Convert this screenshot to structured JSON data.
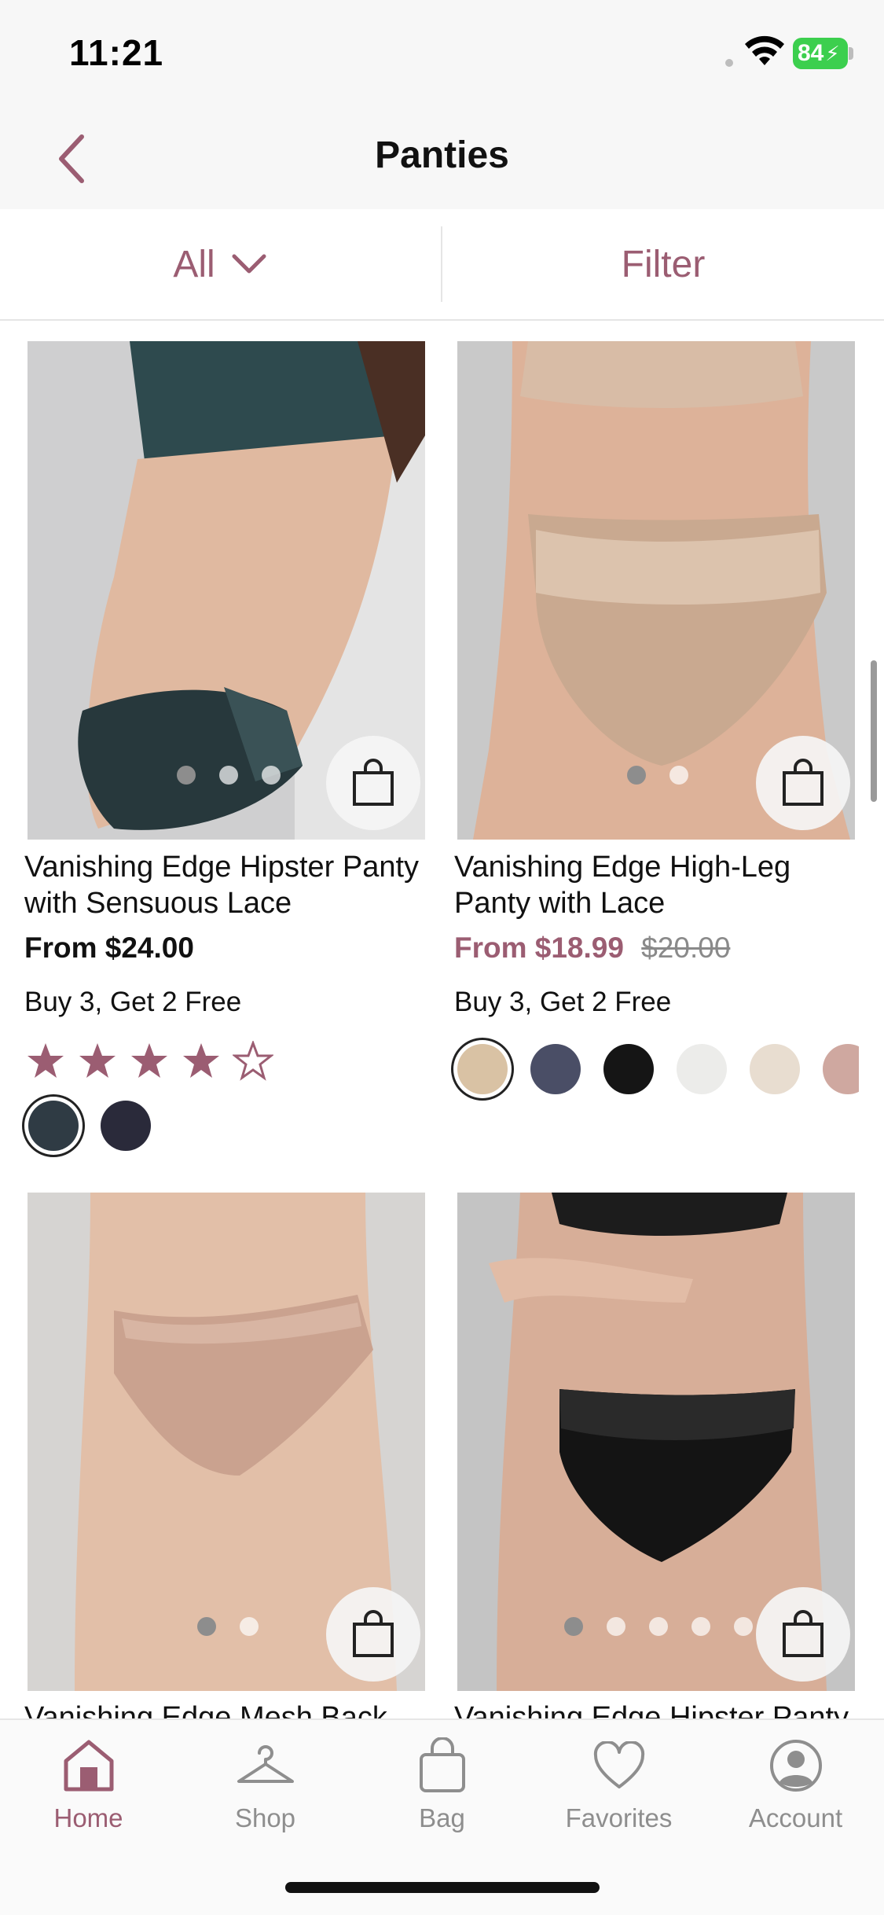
{
  "status_bar": {
    "time": "11:21",
    "battery": "84"
  },
  "header": {
    "title": "Panties",
    "back_icon": "chevron-left-icon"
  },
  "filter_bar": {
    "all_label": "All",
    "filter_label": "Filter"
  },
  "colors": {
    "accent": "#9b5d72",
    "text": "#111111",
    "muted": "#8e8e8e"
  },
  "products": [
    {
      "name_line1": "Vanishing Edge Hipster Panty",
      "name_line2": "with Sensuous Lace",
      "price": "From $24.00",
      "promo": "Buy 3, Get 2 Free",
      "rating": 4,
      "image_dots": 3,
      "active_dot": 0,
      "swatches": [
        "#2f3b44",
        "#2a2a3a"
      ]
    },
    {
      "name_line1": "Vanishing Edge High-Leg",
      "name_line2": "Panty with Lace",
      "sale_price": "From $18.99",
      "original_price": "$20.00",
      "promo": "Buy 3, Get 2 Free",
      "image_dots": 2,
      "active_dot": 0,
      "swatches": [
        "#d9c2a4",
        "#4a4e66",
        "#151515",
        "#ececea",
        "#e8ddd0",
        "#cfa8a0"
      ]
    },
    {
      "name_line1": "Vanishing Edge Mesh Back",
      "image_dots": 2,
      "active_dot": 0
    },
    {
      "name_line1": "Vanishing Edge Hipster Panty",
      "image_dots": 5,
      "active_dot": 0
    }
  ],
  "tab_bar": {
    "tabs": [
      {
        "label": "Home",
        "icon": "home-icon"
      },
      {
        "label": "Shop",
        "icon": "hanger-icon"
      },
      {
        "label": "Bag",
        "icon": "bag-icon"
      },
      {
        "label": "Favorites",
        "icon": "heart-icon"
      },
      {
        "label": "Account",
        "icon": "account-icon"
      }
    ],
    "active": "Home"
  }
}
